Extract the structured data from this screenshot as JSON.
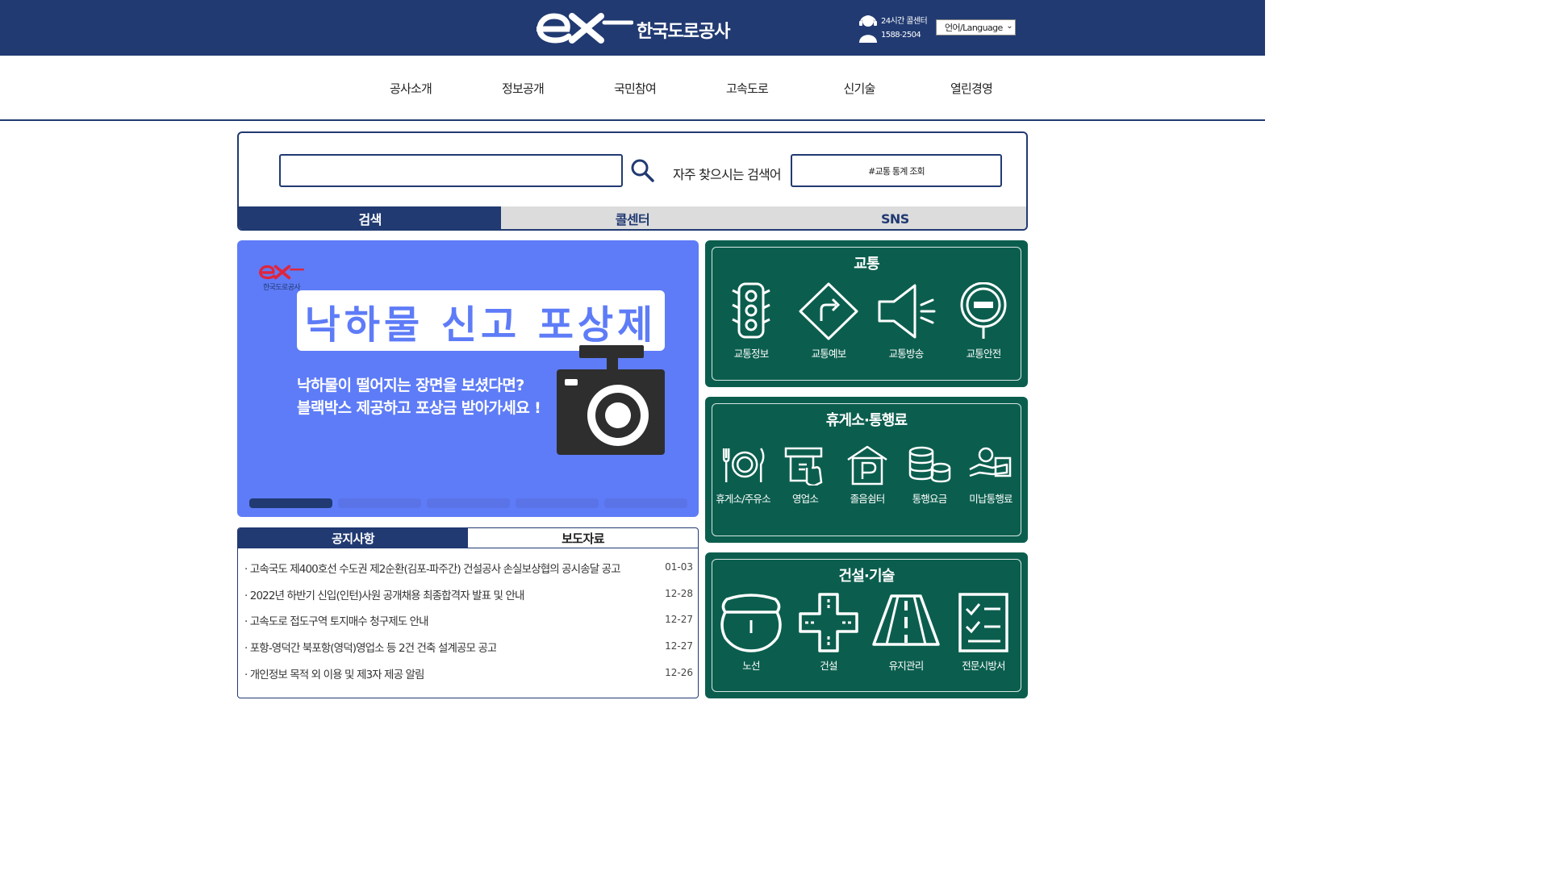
{
  "header": {
    "logo_mark": "ex",
    "logo_name": "한국도로공사",
    "callcenter_label": "24시간 콜센터",
    "callcenter_number": "1588-2504",
    "language_select": "언어/Language"
  },
  "nav": {
    "items": [
      "공사소개",
      "정보공개",
      "국민참여",
      "고속도로",
      "신기술",
      "열린경영"
    ]
  },
  "search": {
    "input_value": "",
    "frequent_label": "자주 찾으시는 검색어",
    "frequent_keyword": "#교통 통계 조회",
    "tabs": [
      "검색",
      "콜센터",
      "SNS"
    ],
    "active_tab": "검색"
  },
  "banner": {
    "logo_text": "한국도로공사",
    "title": "낙하물 신고 포상제",
    "subtitle_line1": "낙하물이 떨어지는 장면을 보셨다면?",
    "subtitle_line2": "블랙박스 제공하고 포상금 받아가세요 !",
    "slide_count": 5,
    "active_slide": 1
  },
  "notice": {
    "tabs": [
      "공지사항",
      "보도자료"
    ],
    "active_tab": "공지사항",
    "items": [
      {
        "title": "· 고속국도 제400호선 수도권 제2순환(김포-파주간) 건설공사 손실보상협의 공시송달 공고",
        "date": "01-03"
      },
      {
        "title": "· 2022년 하반기 신입(인턴)사원 공개채용 최종합격자 발표 및 안내",
        "date": "12-28"
      },
      {
        "title": "· 고속도로 접도구역 토지매수 청구제도 안내",
        "date": "12-27"
      },
      {
        "title": "· 포항-영덕간 북포항(영덕)영업소 등 2건 건축 설계공모 공고",
        "date": "12-27"
      },
      {
        "title": "· 개인정보 목적 외 이용 및 제3자 제공 알림",
        "date": "12-26"
      }
    ]
  },
  "panels": {
    "traffic": {
      "title": "교통",
      "items": [
        {
          "label": "교통정보",
          "icon": "traffic-light-icon"
        },
        {
          "label": "교통예보",
          "icon": "direction-sign-icon"
        },
        {
          "label": "교통방송",
          "icon": "megaphone-icon"
        },
        {
          "label": "교통안전",
          "icon": "no-entry-sign-icon"
        }
      ]
    },
    "rest": {
      "title": "휴게소·통행료",
      "items": [
        {
          "label": "휴게소/주유소",
          "icon": "dining-icon"
        },
        {
          "label": "영업소",
          "icon": "tollbooth-icon"
        },
        {
          "label": "졸음쉼터",
          "icon": "parking-icon"
        },
        {
          "label": "통행요금",
          "icon": "coins-icon"
        },
        {
          "label": "미납통행료",
          "icon": "hand-coin-icon"
        }
      ]
    },
    "construction": {
      "title": "건설·기술",
      "items": [
        {
          "label": "노선",
          "icon": "route-shield-icon"
        },
        {
          "label": "건설",
          "icon": "crossroad-icon"
        },
        {
          "label": "유지관리",
          "icon": "road-icon"
        },
        {
          "label": "전문시방서",
          "icon": "checklist-icon"
        }
      ]
    }
  },
  "colors": {
    "navy": "#213a72",
    "banner_blue": "#5e7cf7",
    "panel_green": "#0b5e4e",
    "tab_gray": "#dcdcdc"
  }
}
